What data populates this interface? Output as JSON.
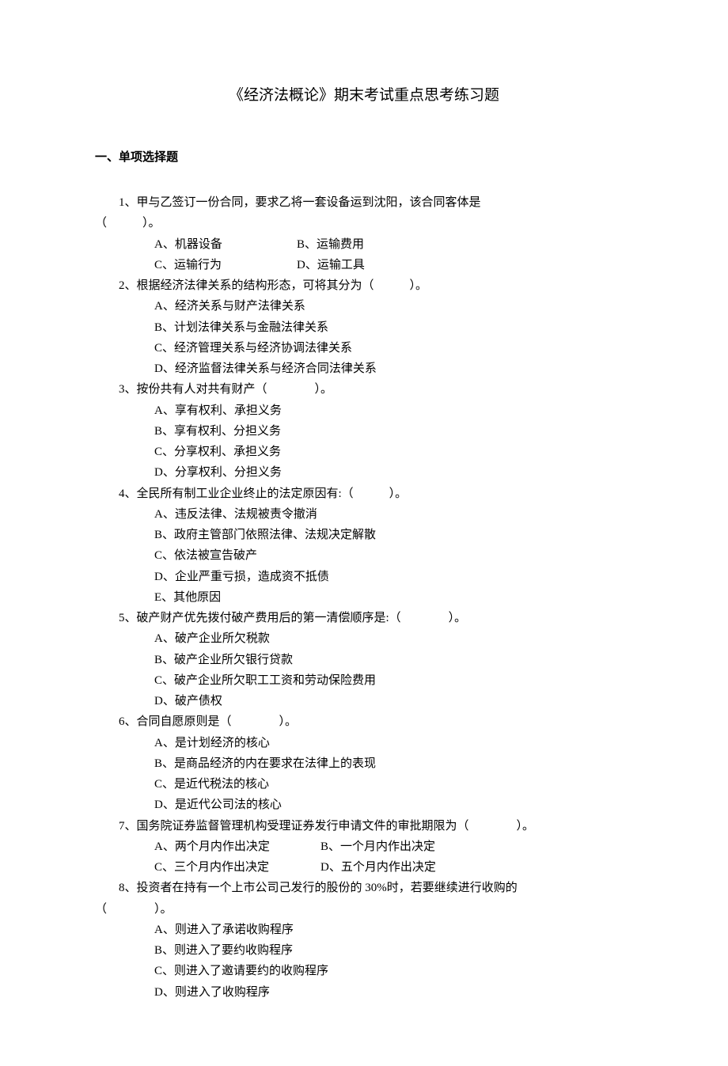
{
  "title": "《经济法概论》期末考试重点思考练习题",
  "section1_header": "一、单项选择题",
  "q1": {
    "stem_line1": "1、甲与乙签订一份合同，要求乙将一套设备运到沈阳，该合同客体是",
    "stem_line2": "（　　　）。",
    "optA": "A、机器设备",
    "optB": "B、运输费用",
    "optC": "C、运输行为",
    "optD": "D、运输工具"
  },
  "q2": {
    "stem": "2、根据经济法律关系的结构形态，可将其分为（　　　）。",
    "optA": "A、经济关系与财产法律关系",
    "optB": "B、计划法律关系与金融法律关系",
    "optC": "C、经济管理关系与经济协调法律关系",
    "optD": "D、经济监督法律关系与经济合同法律关系"
  },
  "q3": {
    "stem": "3、按份共有人对共有财产（　　　　）。",
    "optA": "A、享有权利、承担义务",
    "optB": "B、享有权利、分担义务",
    "optC": "C、分享权利、承担义务",
    "optD": "D、分享权利、分担义务"
  },
  "q4": {
    "stem": "4、全民所有制工业企业终止的法定原因有:（　　　）。",
    "optA": "A、违反法律、法规被责令撤消",
    "optB": "B、政府主管部门依照法律、法规决定解散",
    "optC": "C、依法被宣告破产",
    "optD": "D、企业严重亏损，造成资不抵债",
    "optE": "E、其他原因"
  },
  "q5": {
    "stem": "5、破产财产优先拨付破产费用后的第一清偿顺序是:（　　　　）。",
    "optA": "A、破产企业所欠税款",
    "optB": "B、破产企业所欠银行贷款",
    "optC": "C、破产企业所欠职工工资和劳动保险费用",
    "optD": "D、破产债权"
  },
  "q6": {
    "stem": "6、合同自愿原则是（　　　　）。",
    "optA": "A、是计划经济的核心",
    "optB": "B、是商品经济的内在要求在法律上的表现",
    "optC": "C、是近代税法的核心",
    "optD": "D、是近代公司法的核心"
  },
  "q7": {
    "stem": "7、国务院证券监督管理机构受理证券发行申请文件的审批期限为（　　　　）。",
    "optA": "A、两个月内作出决定",
    "optB": "B、一个月内作出决定",
    "optC": "C、三个月内作出决定",
    "optD": "D、五个月内作出决定"
  },
  "q8": {
    "stem_line1": "8、投资者在持有一个上市公司己发行的股份的 30%时，若要继续进行收购的",
    "stem_line2": "（　　　　）。",
    "optA": "A、则进入了承诺收购程序",
    "optB": "B、则进入了要约收购程序",
    "optC": "C、则进入了邀请要约的收购程序",
    "optD": "D、则进入了收购程序"
  }
}
